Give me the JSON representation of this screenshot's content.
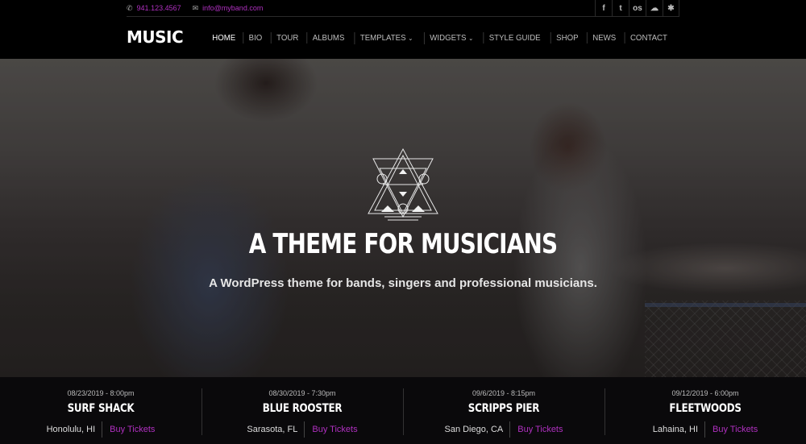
{
  "topbar": {
    "phone": "941.123.4567",
    "email": "info@myband.com",
    "social": [
      {
        "icon": "facebook-icon",
        "glyph": "f"
      },
      {
        "icon": "twitter-icon",
        "glyph": "t"
      },
      {
        "icon": "lastfm-icon",
        "glyph": "os"
      },
      {
        "icon": "soundcloud-icon",
        "glyph": "☁"
      },
      {
        "icon": "yelp-icon",
        "glyph": "✱"
      }
    ]
  },
  "header": {
    "logo": "MUSIC",
    "nav": [
      {
        "label": "HOME",
        "dropdown": false,
        "active": true
      },
      {
        "label": "BIO",
        "dropdown": false
      },
      {
        "label": "TOUR",
        "dropdown": false
      },
      {
        "label": "ALBUMS",
        "dropdown": false
      },
      {
        "label": "TEMPLATES",
        "dropdown": true
      },
      {
        "label": "WIDGETS",
        "dropdown": true
      },
      {
        "label": "STYLE GUIDE",
        "dropdown": false
      },
      {
        "label": "SHOP",
        "dropdown": false
      },
      {
        "label": "NEWS",
        "dropdown": false
      },
      {
        "label": "CONTACT",
        "dropdown": false
      }
    ]
  },
  "hero": {
    "title": "A THEME FOR MUSICIANS",
    "subtitle": "A WordPress theme for bands, singers and professional musicians."
  },
  "events": [
    {
      "date": "08/23/2019 - 8:00pm",
      "venue": "SURF SHACK",
      "city": "Honolulu, HI",
      "cta": "Buy Tickets"
    },
    {
      "date": "08/30/2019 - 7:30pm",
      "venue": "BLUE ROOSTER",
      "city": "Sarasota, FL",
      "cta": "Buy Tickets"
    },
    {
      "date": "09/6/2019 - 8:15pm",
      "venue": "SCRIPPS PIER",
      "city": "San Diego, CA",
      "cta": "Buy Tickets"
    },
    {
      "date": "09/12/2019 - 6:00pm",
      "venue": "FLEETWOODS",
      "city": "Lahaina, HI",
      "cta": "Buy Tickets"
    }
  ],
  "colors": {
    "accent": "#b030c0",
    "background": "#000000"
  }
}
